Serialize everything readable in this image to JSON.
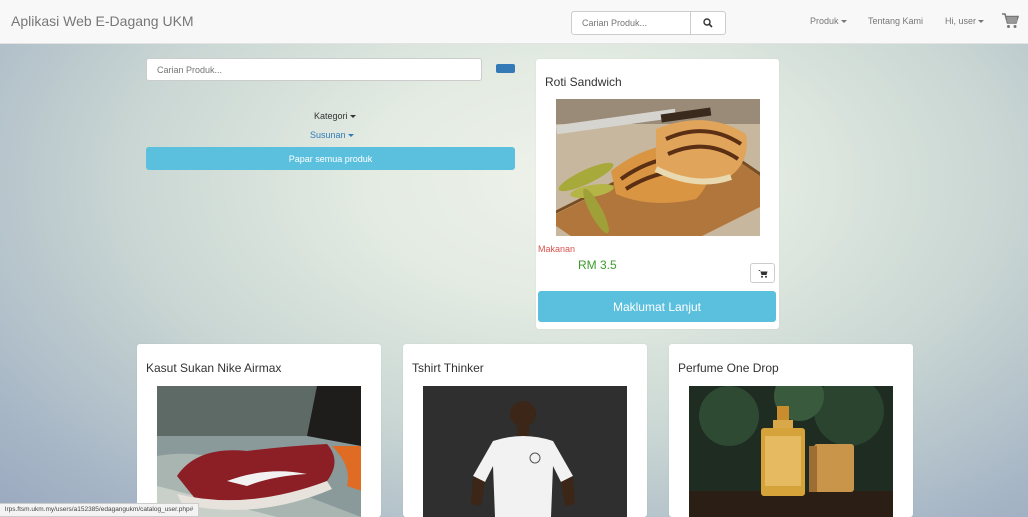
{
  "navbar": {
    "brand": "Aplikasi Web E-Dagang UKM",
    "search_placeholder": "Carian Produk...",
    "produk": "Produk",
    "tentang": "Tentang Kami",
    "user": "Hi, user"
  },
  "filter": {
    "search_placeholder": "Carian Produk...",
    "kategori": "Kategori",
    "susunan": "Susunan",
    "papar_label": "Papar semua produk"
  },
  "products": [
    {
      "name": "Roti Sandwich",
      "category": "Makanan",
      "price": "RM 3.5",
      "detail_label": "Maklumat Lanjut"
    },
    {
      "name": "Kasut Sukan Nike Airmax"
    },
    {
      "name": "Tshirt Thinker"
    },
    {
      "name": "Perfume One Drop"
    }
  ],
  "status_url": "lrps.ftsm.ukm.my/users/a152385/edagangukm/catalog_user.php#",
  "colors": {
    "accent": "#5bc0de",
    "link": "#337ab7",
    "category": "#d9534f",
    "price": "#3c9a2c"
  },
  "icons": [
    "search-icon",
    "cart-icon"
  ]
}
